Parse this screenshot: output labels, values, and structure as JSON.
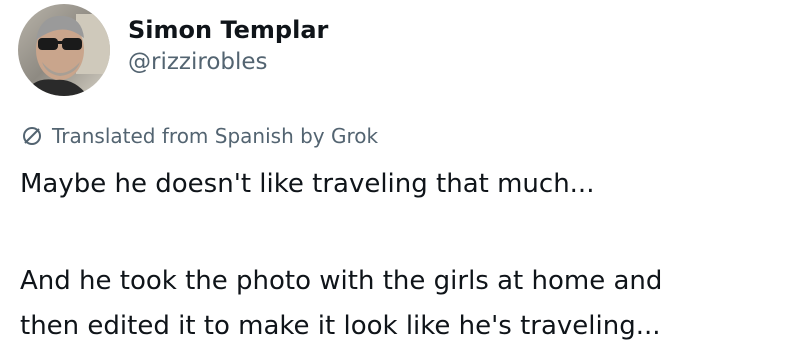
{
  "post": {
    "author": {
      "display_name": "Simon Templar",
      "handle": "@rizzirobles",
      "avatar": "profile-photo"
    },
    "translation_notice": {
      "icon": "translate-icon",
      "text": "Translated from Spanish by Grok"
    },
    "body": {
      "paragraph1": "Maybe he doesn't like traveling that much...",
      "paragraph2_line1": "And he took the photo with the girls at home and",
      "paragraph2_line2": "then edited it to make it look like he's traveling..."
    }
  },
  "colors": {
    "text_primary": "#0f1419",
    "text_secondary": "#536471",
    "background": "#ffffff"
  }
}
